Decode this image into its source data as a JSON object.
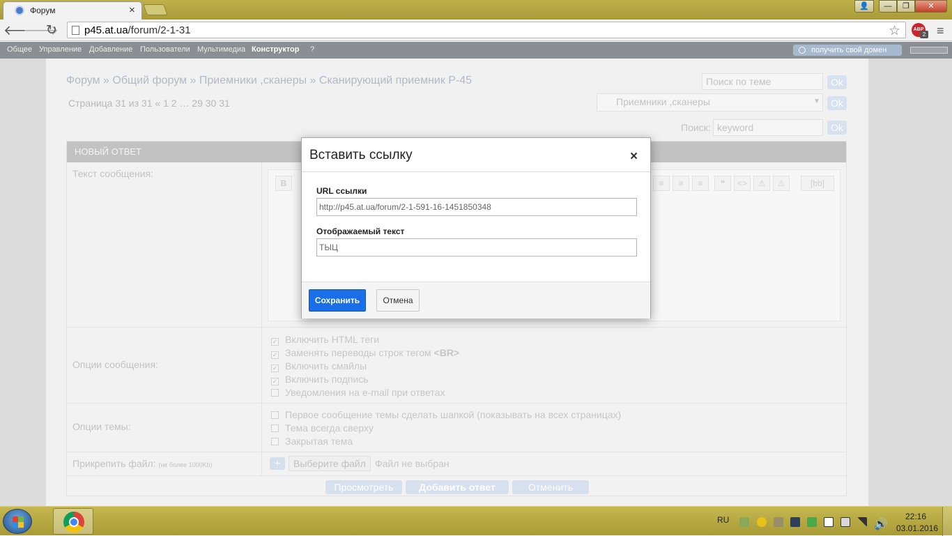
{
  "browser": {
    "tab_title": "Форум",
    "tab_close": "×",
    "url_host": "p45.at.ua",
    "url_path": "/forum/2-1-31",
    "abp_label": "ABP",
    "abp_badge": "2",
    "window_controls": {
      "min": "—",
      "max": "❐",
      "close": "✕",
      "user": "👤"
    }
  },
  "ucoz_bar": {
    "items": [
      "Общее",
      "Управление",
      "Добавление",
      "Пользователи",
      "Мультимедиа",
      "Конструктор",
      "?"
    ],
    "domain_button": "получить свой домен"
  },
  "forum": {
    "breadcrumb": "Форум » Общий форум » Приемники ,сканеры » Сканирующий приемник Р-45",
    "pagination": "Страница 31 из 31  «  1  2  …  29  30  31",
    "topic_search_placeholder": "Поиск по теме",
    "ok": "Ok",
    "category_select": "Приемники ,сканеры",
    "search_label": "Поиск:",
    "search_placeholder": "keyword",
    "new_reply_header": "НОВЫЙ ОТВЕТ",
    "message_text_label": "Текст сообщения:",
    "editor_buttons": [
      "B",
      "≡",
      "≡",
      "≡",
      "❝",
      "<>",
      "⚠",
      "⚠",
      "[bb]"
    ],
    "message_options_label": "Опции сообщения:",
    "message_options": [
      {
        "label": "Включить HTML теги",
        "checked": true
      },
      {
        "label": "Заменять переводы строк тегом ",
        "bold": "<BR>",
        "checked": true
      },
      {
        "label": "Включить смайлы",
        "checked": true
      },
      {
        "label": "Включить подпись",
        "checked": true
      },
      {
        "label": "Уведомления на e-mail при ответах",
        "checked": false
      }
    ],
    "topic_options_label": "Опции темы:",
    "topic_options": [
      "Первое сообщение темы сделать шапкой (показывать на всех страницах)",
      "Тема всегда сверху",
      "Закрытая тема"
    ],
    "attach_label": "Прикрепить файл:",
    "attach_hint": "(не более 1000Kb)",
    "plus": "+",
    "choose_file": "Выберите файл",
    "no_file": "Файл не выбран",
    "btn_preview": "Просмотреть",
    "btn_add_reply": "Добавить ответ",
    "btn_cancel": "Отменить"
  },
  "modal": {
    "title": "Вставить ссылку",
    "close": "×",
    "url_label": "URL ссылки",
    "url_value": "http://p45.at.ua/forum/2-1-591-16-1451850348",
    "text_label": "Отображаемый текст",
    "text_value": "ТЫЦ",
    "save": "Сохранить",
    "cancel": "Отмена"
  },
  "taskbar": {
    "lang": "RU",
    "time": "22:16",
    "date": "03.01.2016"
  },
  "colors": {
    "primary_button": "#1a6fe8",
    "titlebar": "#bfb04a"
  }
}
